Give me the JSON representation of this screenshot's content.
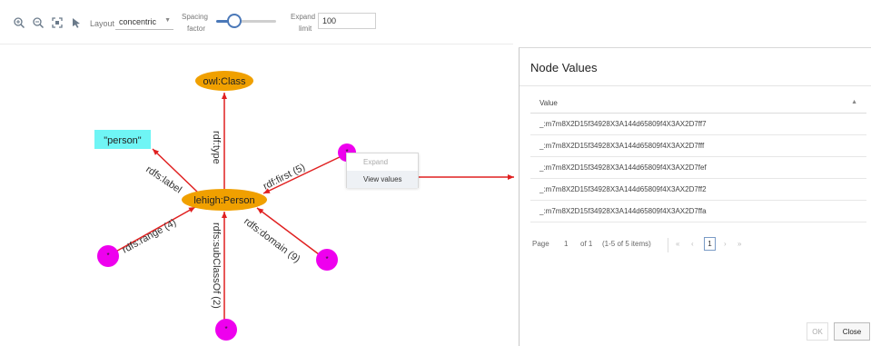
{
  "toolbar": {
    "icons": [
      "zoom-in-icon",
      "zoom-out-icon",
      "fit-to-screen-icon",
      "select-pointer-icon"
    ],
    "layout_label": "Layout",
    "layout_value": "concentric",
    "spacing_label_1": "Spacing",
    "spacing_label_2": "factor",
    "spacing_level": 0.3,
    "expand_label_1": "Expand",
    "expand_label_2": "limit",
    "expand_value": "100"
  },
  "graph": {
    "nodes": {
      "center": "lehigh:Person",
      "owl_class": "owl:Class",
      "person_literal": "\"person\"",
      "blank_star": "*"
    },
    "edges": {
      "rdf_type": "rdf:type",
      "rdfs_label": "rdfs:label",
      "rdf_first": "rdf:first (5)",
      "rdfs_range": "rdfs:range (4)",
      "rdfs_domain": "rdfs:domain (9)",
      "rdfs_subclassof": "rdfs:subClassOf (2)"
    },
    "colors": {
      "node_orange": "#f0a000",
      "node_magenta": "#ee00ee",
      "literal_cyan": "#6ff5f5",
      "edge_red": "#e02020"
    }
  },
  "context_menu": {
    "expand": "Expand",
    "view_values": "View values"
  },
  "dialog": {
    "title": "Node Values",
    "column_header": "Value",
    "rows": [
      "_:m7m8X2D15f34928X3A144d65809f4X3AX2D7ff7",
      "_:m7m8X2D15f34928X3A144d65809f4X3AX2D7fff",
      "_:m7m8X2D15f34928X3A144d65809f4X3AX2D7fef",
      "_:m7m8X2D15f34928X3A144d65809f4X3AX2D7ff2",
      "_:m7m8X2D15f34928X3A144d65809f4X3AX2D7ffa"
    ],
    "pager": {
      "page_label": "Page",
      "page_number": "1",
      "of_label": "of 1",
      "items_info": "(1-5 of 5 items)",
      "current": "1"
    },
    "ok_label": "OK",
    "close_label": "Close"
  }
}
